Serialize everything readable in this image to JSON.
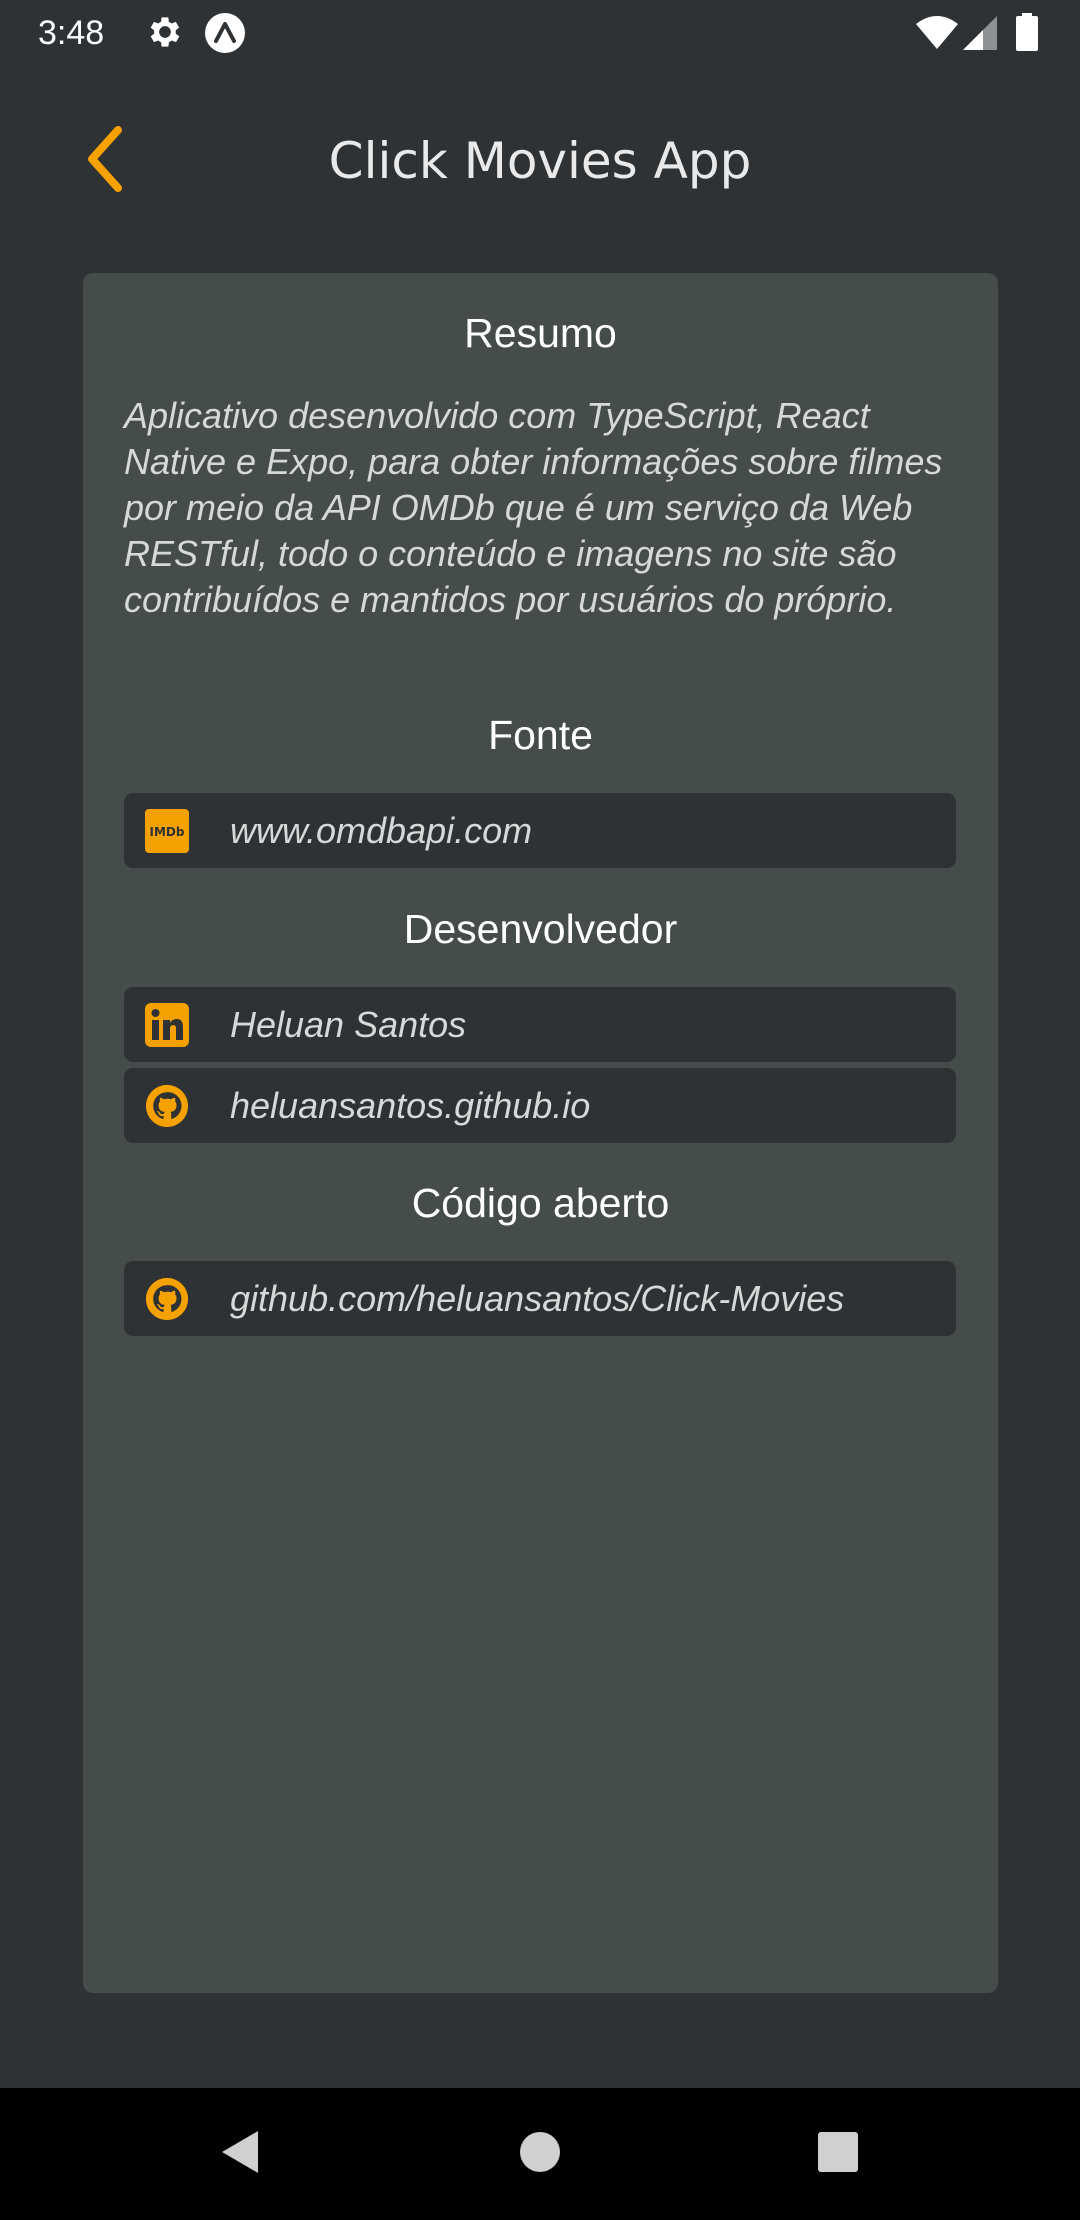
{
  "status_bar": {
    "time": "3:48",
    "icons": [
      "gear-icon",
      "expo-icon",
      "wifi-icon",
      "signal-icon",
      "battery-icon"
    ]
  },
  "header": {
    "title": "Click Movies App",
    "back_icon": "chevron-left-icon"
  },
  "colors": {
    "accent": "#f5a100",
    "background": "#2f3235",
    "card": "#454c4a"
  },
  "card": {
    "summary": {
      "title": "Resumo",
      "text": "Aplicativo desenvolvido com TypeScript, React Native e Expo, para obter informações sobre filmes por meio da API OMDb que é um serviço da Web RESTful, todo o conteúdo e imagens no site são contribuídos e mantidos por usuários do próprio."
    },
    "source": {
      "title": "Fonte",
      "links": [
        {
          "icon": "imdb-icon",
          "label": "www.omdbapi.com"
        }
      ]
    },
    "developer": {
      "title": "Desenvolvedor",
      "links": [
        {
          "icon": "linkedin-icon",
          "label": "Heluan Santos"
        },
        {
          "icon": "github-icon",
          "label": "heluansantos.github.io"
        }
      ]
    },
    "open_source": {
      "title": "Código aberto",
      "links": [
        {
          "icon": "github-icon",
          "label": "github.com/heluansantos/Click-Movies"
        }
      ]
    }
  },
  "nav_bar": {
    "buttons": [
      "back-triangle-icon",
      "home-circle-icon",
      "overview-square-icon"
    ]
  }
}
